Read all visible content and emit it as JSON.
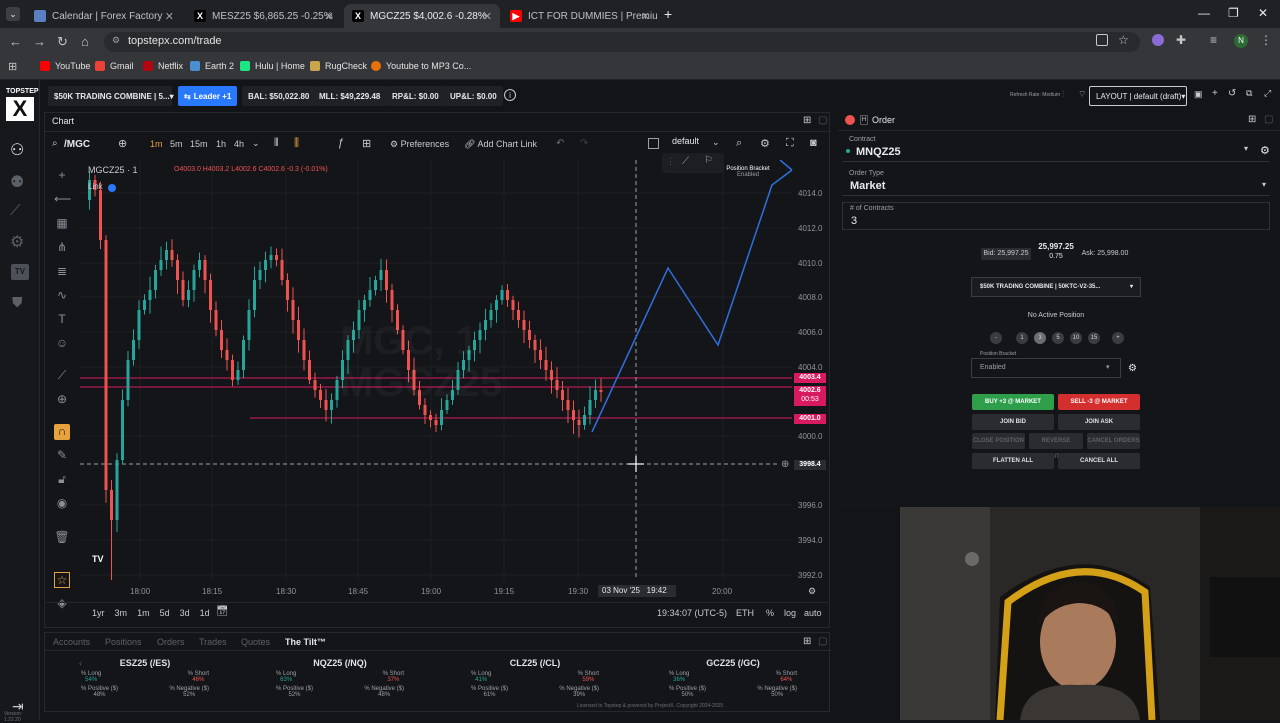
{
  "browser": {
    "tabs": [
      {
        "title": "Calendar | Forex Factory",
        "icon": "forexfactory-icon",
        "color": "#5a7fbf"
      },
      {
        "title": "MESZ25 $6,865.25 -0.25%",
        "icon": "topstep-icon",
        "color": "#ffffff"
      },
      {
        "title": "MGCZ25 $4,002.6 -0.28%",
        "icon": "topstep-icon",
        "color": "#ffffff",
        "active": true
      },
      {
        "title": "ICT FOR DUMMIES | Premium",
        "icon": "youtube-icon",
        "color": "#ff0000"
      }
    ],
    "url": "topstepx.com/trade",
    "bookmarks": [
      "YouTube",
      "Gmail",
      "Netflix",
      "Earth 2",
      "Hulu | Home",
      "RugCheck",
      "Youtube to MP3 Co..."
    ]
  },
  "topbar": {
    "account": "$50K TRADING COMBINE | 5...",
    "leader": "Leader +1",
    "bal": "BAL: $50,022.80",
    "mll": "MLL: $49,229.48",
    "rpl": "RP&L: $0.00",
    "upl": "UP&L: $0.00",
    "refresh": "Refresh Rate: Medium",
    "layout": "LAYOUT | default (draft)"
  },
  "chart": {
    "panel_title": "Chart",
    "symbol": "/MGC",
    "intervals": [
      "1m",
      "5m",
      "15m",
      "1h",
      "4h"
    ],
    "preferences": "Preferences",
    "add_link": "Add Chart Link",
    "template": "default",
    "legend_symbol": "MGCZ25 · 1",
    "ohlc": "O4003.0  H4003.2  L4002.6  C4002.6  -0.3 (-0.01%)",
    "link_label": "Link",
    "watermark_line1": "MGC, 1",
    "watermark_line2": "MGCZ25",
    "bracket_title": "Position Bracket",
    "bracket_state": "Enabled",
    "price_labels": [
      "4014.0",
      "4012.0",
      "4010.0",
      "4008.0",
      "4006.0",
      "4004.0",
      "4000.0",
      "3996.0",
      "3994.0",
      "3992.0"
    ],
    "tag_upper": "4003.4",
    "tag_last": "4002.6",
    "tag_timer": "00:53",
    "tag_lower": "4001.0",
    "tag_cursor": "3998.4",
    "time_labels": [
      "18:00",
      "18:15",
      "18:30",
      "18:45",
      "19:00",
      "19:15",
      "19:30",
      "20:00"
    ],
    "cursor_date": "03 Nov '25",
    "cursor_time": "19:42",
    "ranges": [
      "1yr",
      "3m",
      "1m",
      "5d",
      "3d",
      "1d"
    ],
    "clock": "19:34:07 (UTC-5)",
    "session": "ETH",
    "pct": "%",
    "log": "log",
    "auto": "auto"
  },
  "bottom": {
    "tabs": [
      "Accounts",
      "Positions",
      "Orders",
      "Trades",
      "Quotes",
      "The Tilt™"
    ],
    "tilt": [
      {
        "name": "ESZ25 (/ES)",
        "long": "54%",
        "short": "46%",
        "pos": "48%",
        "neg": "52%"
      },
      {
        "name": "NQZ25 (/NQ)",
        "long": "63%",
        "short": "37%",
        "pos": "52%",
        "neg": "48%"
      },
      {
        "name": "CLZ25 (/CL)",
        "long": "41%",
        "short": "59%",
        "pos": "61%",
        "neg": "39%"
      },
      {
        "name": "GCZ25 (/GC)",
        "long": "36%",
        "short": "64%",
        "pos": "50%",
        "neg": "50%"
      }
    ],
    "lbl_long": "% Long",
    "lbl_short": "% Short",
    "lbl_pos": "% Positive ($)",
    "lbl_neg": "% Negative ($)",
    "version": "Version: 1.22.20",
    "license": "Licensed to Topstep & powered by ProjectX. Copyright 2024-2025"
  },
  "order": {
    "title": "Order",
    "contract_label": "Contract",
    "contract": "MNQZ25",
    "type_label": "Order Type",
    "type": "Market",
    "qty_label": "# of Contracts",
    "qty": "3",
    "bid": "Bid: 25,997.25",
    "mid": "25,997.25",
    "spread": "0.75",
    "ask": "Ask: 25,998.00",
    "account": "$50K TRADING COMBINE | 50KTC-V2-35...",
    "no_position": "No Active Position",
    "qty_buttons": [
      "-",
      "1",
      "3",
      "5",
      "10",
      "15",
      "+"
    ],
    "bracket_label": "Position Bracket",
    "bracket_value": "Enabled",
    "buy": "BUY +3 @ MARKET",
    "sell": "SELL -3 @ MARKET",
    "join_bid": "JOIN BID",
    "join_ask": "JOIN ASK",
    "close_position": "CLOSE POSITION",
    "reverse_position": "REVERSE POSITION",
    "cancel_orders": "CANCEL ORDERS",
    "flatten": "FLATTEN ALL",
    "cancel_all": "CANCEL ALL"
  },
  "colors": {
    "up": "#26a69a",
    "down": "#ef5350",
    "buy": "#2e9e4b",
    "sell": "#d32f2f",
    "accent": "#2979ff",
    "line": "#2f6fde"
  }
}
